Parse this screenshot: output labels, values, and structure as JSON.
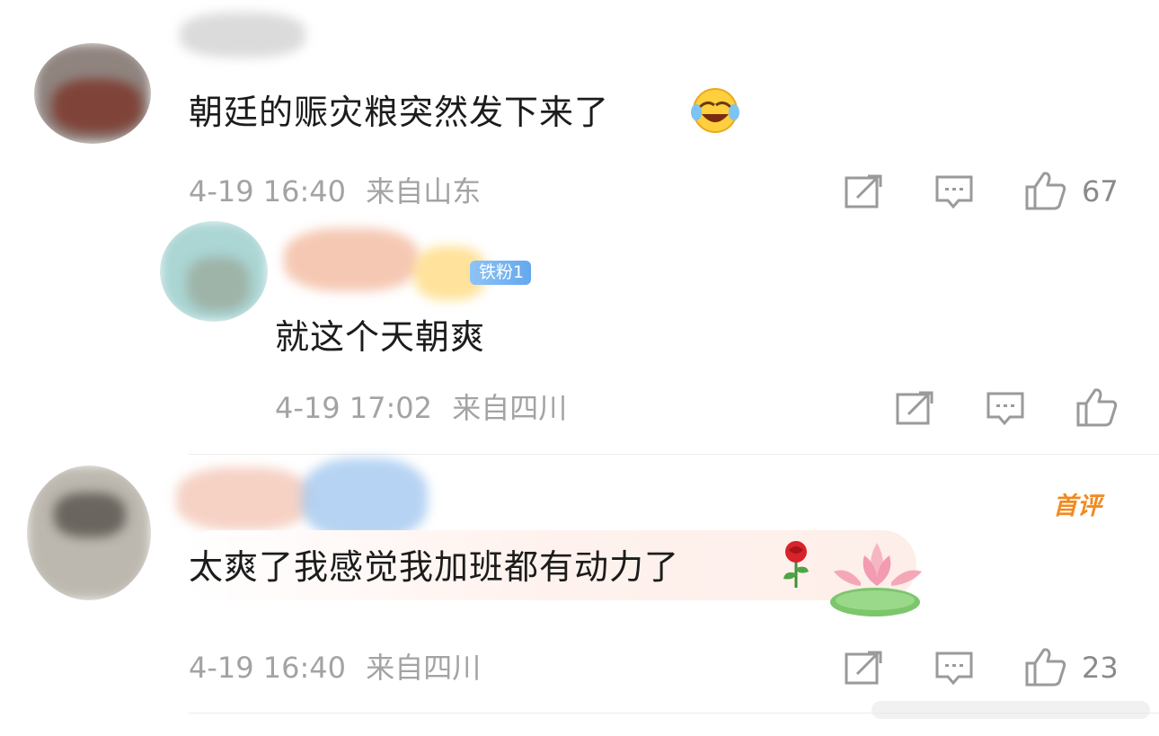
{
  "comments": [
    {
      "text": "朝廷的赈灾粮突然发下来了",
      "emoji": "laugh-cry-emoji",
      "time": "4-19 16:40",
      "location": "来自山东",
      "likes": "67"
    },
    {
      "badge": "铁粉1",
      "text": "就这个天朝爽",
      "time": "4-19 17:02",
      "location": "来自四川"
    },
    {
      "tag": "首评",
      "text": "太爽了我感觉我加班都有动力了",
      "emoji": "rose-emoji",
      "decoration": "lotus-sticker",
      "time": "4-19 16:40",
      "location": "来自四川",
      "likes": "23"
    }
  ],
  "colors": {
    "text": "#1c1c1c",
    "meta": "#a3a3a3",
    "icon": "#9a9a9a",
    "badge": "#64a8ef",
    "first_tag": "#f28a1f"
  },
  "icons": [
    "share-icon",
    "comment-icon",
    "like-icon"
  ]
}
